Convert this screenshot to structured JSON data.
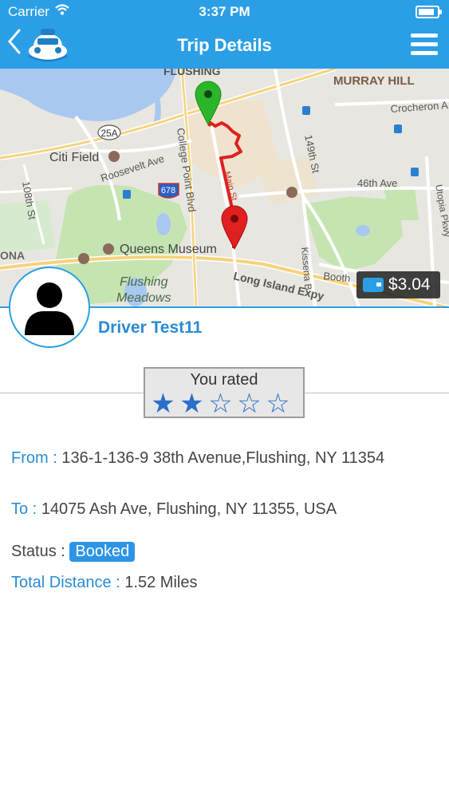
{
  "status_bar": {
    "carrier": "Carrier",
    "time": "3:37 PM"
  },
  "header": {
    "title": "Trip Details"
  },
  "map": {
    "labels": {
      "flushing": "FLUSHING",
      "murray_hill": "MURRAY HILL",
      "crocheron": "Crocheron A",
      "route_25a": "25A",
      "citi_field": "Citi Field",
      "roosevelt": "Roosevelt Ave",
      "college_point": "College Point Blvd",
      "st_149": "149th St",
      "st_108": "108th St",
      "ave_46": "46th Ave",
      "utopia": "Utopia Pkwy",
      "route_678": "678",
      "main_st": "Main St",
      "ona": "ONA",
      "queens_museum": "Queens Museum",
      "kissena": "Kissena B",
      "booth": "Booth",
      "flushing_meadows_1": "Flushing",
      "flushing_meadows_2": "Meadows",
      "lie": "Long Island Expy"
    },
    "fare": "$3.04"
  },
  "driver": {
    "name": "Driver Test11"
  },
  "rating": {
    "label": "You rated",
    "value": 2,
    "max": 5
  },
  "trip": {
    "from_label": "From :",
    "from_value": "136-1-136-9 38th Avenue,Flushing, NY 11354",
    "to_label": "To :",
    "to_value": "14075 Ash Ave, Flushing, NY 11355, USA",
    "status_label": "Status :",
    "status_value": "Booked",
    "distance_label": "Total Distance :",
    "distance_value": "1.52 Miles"
  },
  "colors": {
    "accent": "#2b9fe6",
    "link": "#2a8bd4",
    "route": "#e02020",
    "start_pin": "#2bb52b",
    "end_pin": "#e02020"
  }
}
